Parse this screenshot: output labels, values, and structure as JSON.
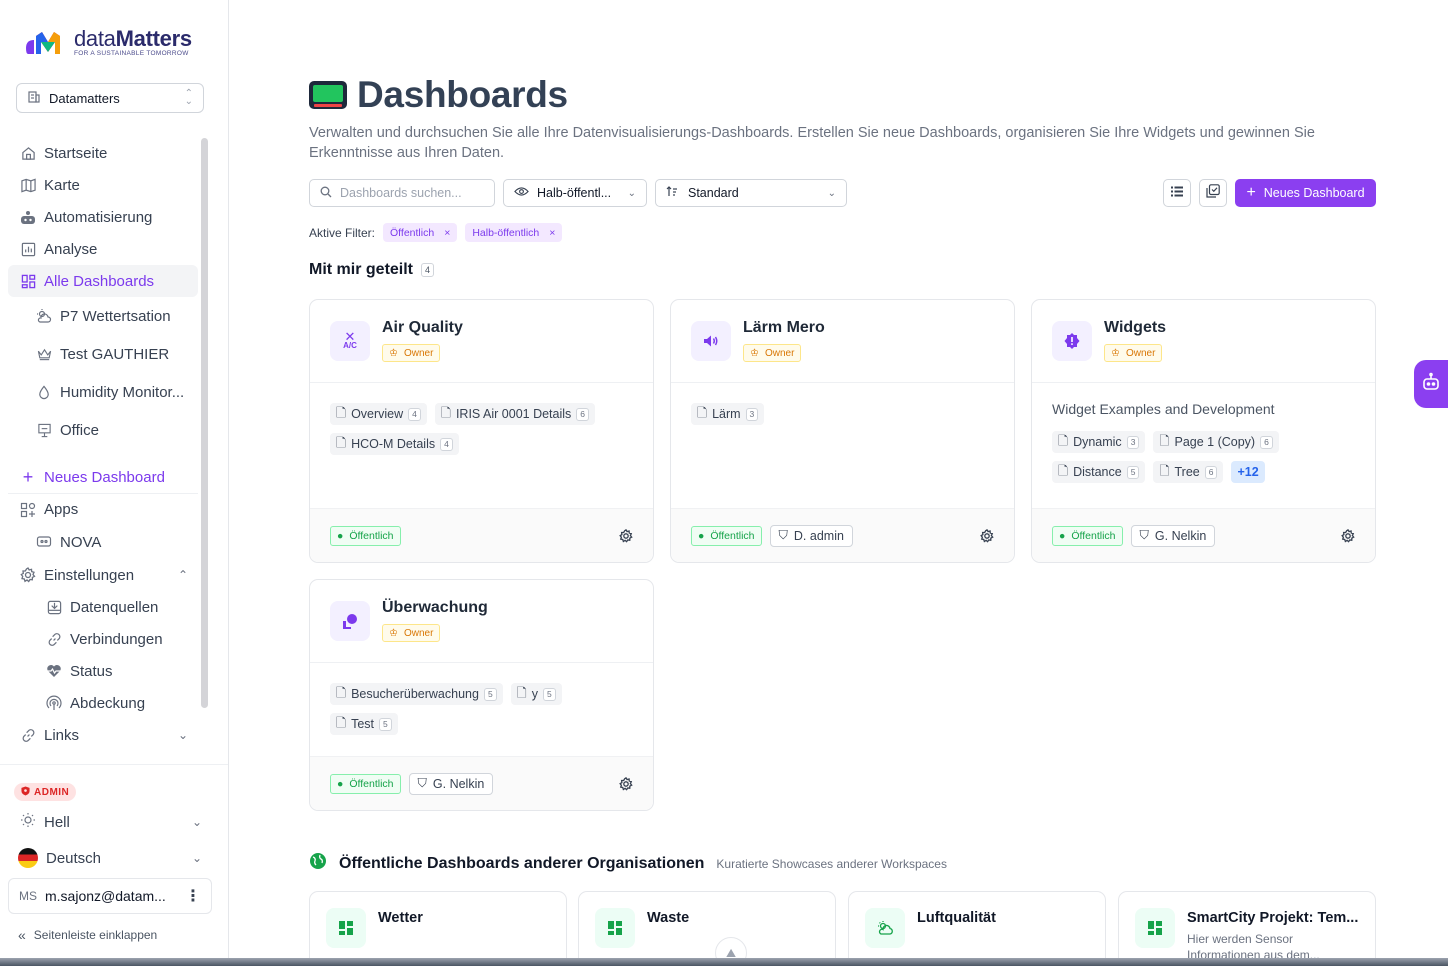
{
  "brand": {
    "name_light": "data",
    "name_bold": "Matters",
    "tagline": "FOR A SUSTAINABLE TOMORROW"
  },
  "org_selector": {
    "value": "Datamatters"
  },
  "nav": {
    "startseite": "Startseite",
    "karte": "Karte",
    "automatisierung": "Automatisierung",
    "analyse": "Analyse",
    "alle_dashboards": "Alle Dashboards",
    "dashboards": [
      "P7 Wettertsation",
      "Test GAUTHIER",
      "Humidity Monitor...",
      "Office"
    ],
    "neues_dashboard": "Neues Dashboard",
    "apps": "Apps",
    "nova": "NOVA",
    "einstellungen": "Einstellungen",
    "settings_items": [
      "Datenquellen",
      "Verbindungen",
      "Status",
      "Abdeckung"
    ],
    "links": "Links"
  },
  "admin_badge": "ADMIN",
  "theme": {
    "label": "Hell"
  },
  "language": {
    "label": "Deutsch"
  },
  "user": {
    "initials": "MS",
    "email": "m.sajonz@datam..."
  },
  "collapse_label": "Seitenleiste einklappen",
  "page": {
    "title": "Dashboards",
    "description": "Verwalten und durchsuchen Sie alle Ihre Datenvisualisierungs-Dashboards. Erstellen Sie neue Dashboards, organisieren Sie Ihre Widgets und gewinnen Sie Erkenntnisse aus Ihren Daten."
  },
  "toolbar": {
    "search_placeholder": "Dashboards suchen...",
    "visibility_value": "Halb-öffentl...",
    "sort_value": "Standard",
    "new_button": "Neues Dashboard"
  },
  "filters": {
    "label": "Aktive Filter:",
    "chips": [
      "Öffentlich",
      "Halb-öffentlich"
    ]
  },
  "shared_section": {
    "title": "Mit mir geteilt",
    "count": "4"
  },
  "owner_label": "Owner",
  "public_label": "Öffentlich",
  "cards": [
    {
      "title": "Air Quality",
      "icon_text": "A/C",
      "description": "",
      "pages": [
        {
          "name": "Overview",
          "n": "4"
        },
        {
          "name": "IRIS Air 0001 Details",
          "n": "6"
        },
        {
          "name": "HCO-M Details",
          "n": "4"
        }
      ],
      "user": ""
    },
    {
      "title": "Lärm Mero",
      "description": "",
      "pages": [
        {
          "name": "Lärm",
          "n": "3"
        }
      ],
      "user": "D. admin"
    },
    {
      "title": "Widgets",
      "description": "Widget Examples and Development",
      "pages": [
        {
          "name": "Dynamic",
          "n": "3"
        },
        {
          "name": "Page 1 (Copy)",
          "n": "6"
        },
        {
          "name": "Distance",
          "n": "5"
        },
        {
          "name": "Tree",
          "n": "6"
        }
      ],
      "more": "+12",
      "user": "G. Nelkin"
    },
    {
      "title": "Überwachung",
      "description": "",
      "pages": [
        {
          "name": "Besucherüberwachung",
          "n": "5"
        },
        {
          "name": "y",
          "n": "5"
        },
        {
          "name": "Test",
          "n": "5"
        }
      ],
      "user": "G. Nelkin"
    }
  ],
  "public_section": {
    "title": "Öffentliche Dashboards anderer Organisationen",
    "subtitle": "Kuratierte Showcases anderer Workspaces"
  },
  "public_cards": [
    {
      "title": "Wetter",
      "subtitle": ""
    },
    {
      "title": "Waste",
      "subtitle": ""
    },
    {
      "title": "Luftqualität",
      "subtitle": ""
    },
    {
      "title": "SmartCity Projekt: Tem...",
      "subtitle": "Hier werden Sensor Informationen aus dem..."
    }
  ]
}
